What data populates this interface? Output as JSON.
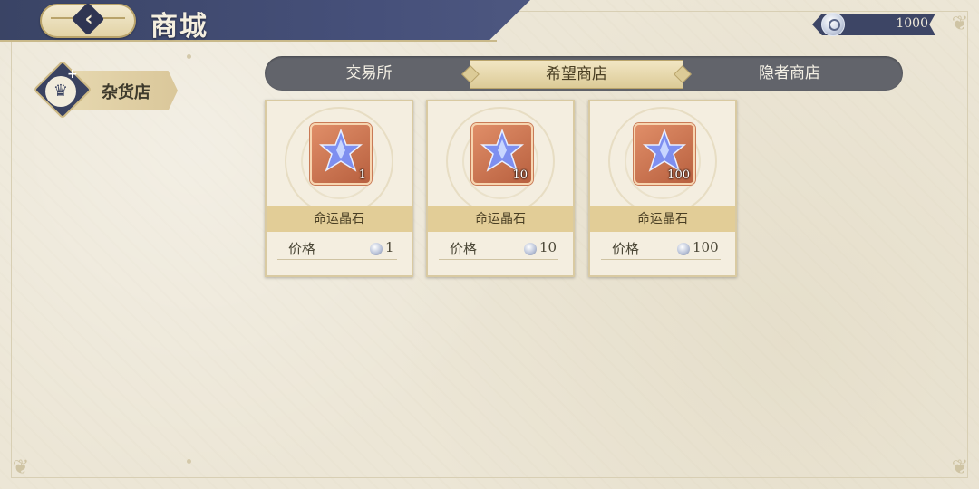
{
  "header": {
    "title": "商城",
    "back_icon": "back-arrow-icon"
  },
  "currency": {
    "icon": "crystal-coin-icon",
    "amount": "1000"
  },
  "sidebar": {
    "items": [
      {
        "label": "杂货店",
        "icon": "crown-icon",
        "selected": true
      }
    ]
  },
  "tabs": [
    {
      "label": "交易所",
      "active": false
    },
    {
      "label": "希望商店",
      "active": true
    },
    {
      "label": "隐者商店",
      "active": false
    }
  ],
  "shop_items": [
    {
      "name": "命运晶石",
      "quantity": "1",
      "price_label": "价格",
      "price": "1",
      "icon": "destiny-crystal-icon"
    },
    {
      "name": "命运晶石",
      "quantity": "10",
      "price_label": "价格",
      "price": "10",
      "icon": "destiny-crystal-icon"
    },
    {
      "name": "命运晶石",
      "quantity": "100",
      "price_label": "价格",
      "price": "100",
      "icon": "destiny-crystal-icon"
    }
  ],
  "colors": {
    "header_bg": "#46507a",
    "accent_gold": "#dccb97",
    "tab_bar": "#62646b",
    "card_bg": "#f4eee0"
  }
}
